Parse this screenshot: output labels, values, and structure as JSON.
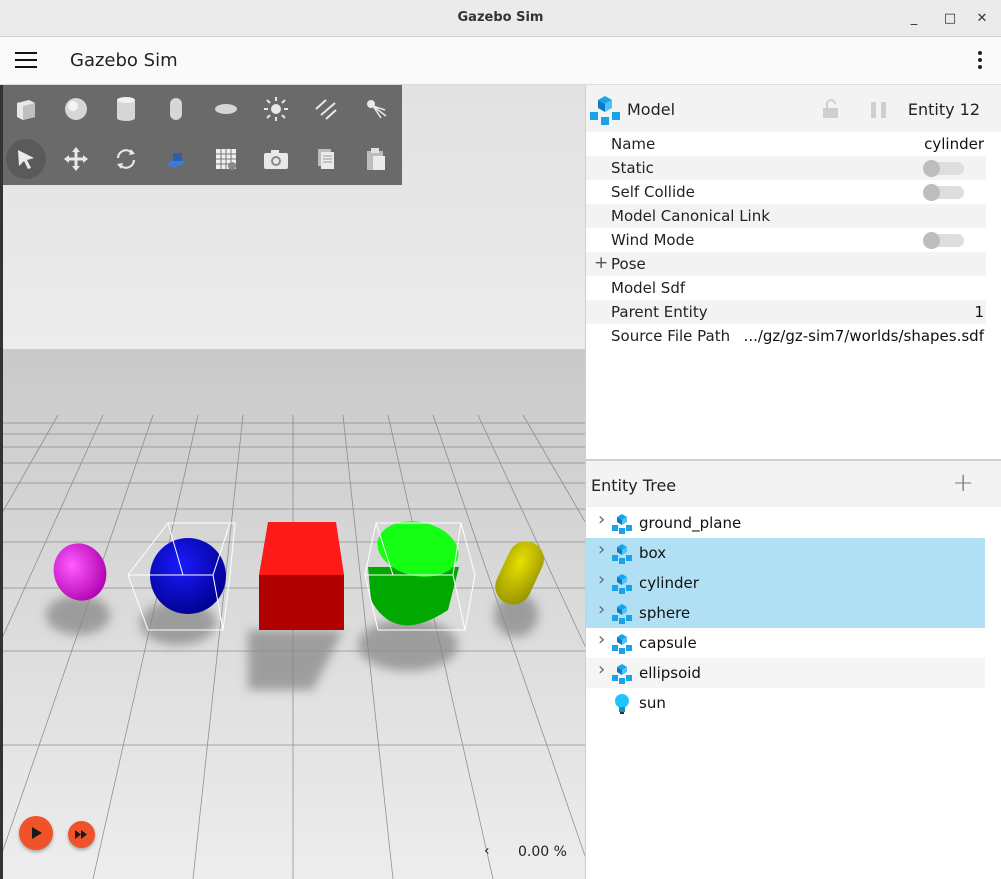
{
  "window": {
    "title": "Gazebo Sim",
    "minimize": "_",
    "maximize": "□",
    "close": "✕"
  },
  "app": {
    "title": "Gazebo Sim"
  },
  "toolbar": {
    "row1": [
      "box-icon",
      "sphere-icon",
      "cylinder-icon",
      "capsule-icon",
      "ellipsoid-icon",
      "point-light-icon",
      "directional-light-icon",
      "spot-light-icon"
    ],
    "row2": [
      "select-icon",
      "translate-icon",
      "rotate-icon",
      "snap-icon",
      "grid-icon",
      "screenshot-icon",
      "copy-icon",
      "paste-icon"
    ]
  },
  "playback": {
    "rtf_arrow": "‹",
    "rtf": "0.00 %"
  },
  "component_inspector": {
    "title": "Model",
    "entity": "Entity 12",
    "rows": [
      {
        "key": "Name",
        "value": "cylinder"
      },
      {
        "key": "Static",
        "toggle": false
      },
      {
        "key": "Self Collide",
        "toggle": false
      },
      {
        "key": "Model Canonical Link",
        "value": ""
      },
      {
        "key": "Wind Mode",
        "toggle": false
      },
      {
        "key": "Pose",
        "expander": "+"
      },
      {
        "key": "Model Sdf",
        "value": ""
      },
      {
        "key": "Parent Entity",
        "value": "1"
      },
      {
        "key": "Source File Path",
        "value": ".../gz/gz-sim7/worlds/shapes.sdf"
      }
    ]
  },
  "entity_tree": {
    "title": "Entity Tree",
    "add": "+",
    "items": [
      {
        "label": "ground_plane",
        "icon": "model-icon",
        "selected": false
      },
      {
        "label": "box",
        "icon": "model-icon",
        "selected": true
      },
      {
        "label": "cylinder",
        "icon": "model-icon",
        "selected": true
      },
      {
        "label": "sphere",
        "icon": "model-icon",
        "selected": true
      },
      {
        "label": "capsule",
        "icon": "model-icon",
        "selected": false
      },
      {
        "label": "ellipsoid",
        "icon": "model-icon",
        "selected": false
      },
      {
        "label": "sun",
        "icon": "light-bulb-icon",
        "selected": false
      }
    ]
  },
  "colors": {
    "accent": "#f0522a",
    "selection": "#b1e0f5",
    "toolbar": "#6a6a6a",
    "model_icon": "#1aa3e8"
  }
}
